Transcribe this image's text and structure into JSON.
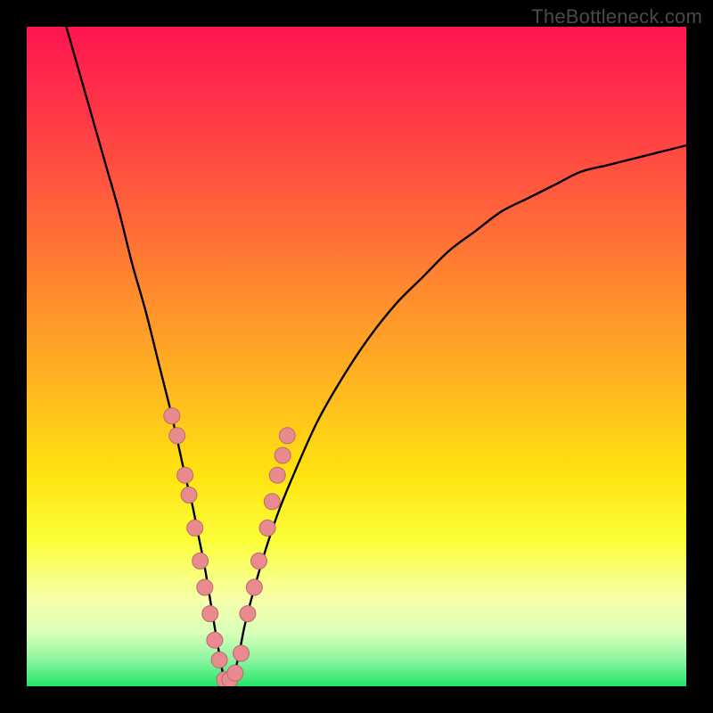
{
  "watermark": "TheBottleneck.com",
  "colors": {
    "frame": "#000000",
    "curve": "#000000",
    "marker_fill": "#e98a8f",
    "marker_stroke": "#b96a6f",
    "gradient_stops": [
      "#ff1450",
      "#ff2f49",
      "#ff5a3d",
      "#ff8a2e",
      "#ffb81f",
      "#ffe310",
      "#fbff3a",
      "#f6ffac",
      "#d8ffb8",
      "#8cf5a0",
      "#22e56a"
    ]
  },
  "chart_data": {
    "type": "line",
    "title": "",
    "xlabel": "",
    "ylabel": "",
    "xlim": [
      0,
      100
    ],
    "ylim": [
      0,
      100
    ],
    "grid": false,
    "legend": false,
    "curve": {
      "name": "bottleneck-curve",
      "comment": "V-shaped curve. y is bottleneck %, x is relative component balance. Values estimated from pixel positions; minimum ≈ 0 at x ≈ 30.",
      "x": [
        6,
        8,
        10,
        12,
        14,
        16,
        18,
        20,
        22,
        24,
        25,
        26,
        27,
        28,
        29,
        30,
        31,
        32,
        33,
        34,
        36,
        38,
        40,
        44,
        48,
        52,
        56,
        60,
        64,
        68,
        72,
        76,
        80,
        84,
        88,
        92,
        96,
        100
      ],
      "y": [
        100,
        93,
        86,
        79,
        72,
        64,
        57,
        49,
        41,
        32,
        28,
        23,
        18,
        12,
        6,
        1,
        1,
        4,
        9,
        13,
        20,
        26,
        31,
        40,
        47,
        53,
        58,
        62,
        66,
        69,
        72,
        74,
        76,
        78,
        79,
        80,
        81,
        82
      ]
    },
    "markers": {
      "name": "sample-points",
      "comment": "Salmon dots clustered near the valley on both arms.",
      "points": [
        {
          "x": 22.0,
          "y": 41
        },
        {
          "x": 22.8,
          "y": 38
        },
        {
          "x": 24.0,
          "y": 32
        },
        {
          "x": 24.6,
          "y": 29
        },
        {
          "x": 25.5,
          "y": 24
        },
        {
          "x": 26.3,
          "y": 19
        },
        {
          "x": 27.0,
          "y": 15
        },
        {
          "x": 27.8,
          "y": 11
        },
        {
          "x": 28.5,
          "y": 7
        },
        {
          "x": 29.2,
          "y": 4
        },
        {
          "x": 30.0,
          "y": 1
        },
        {
          "x": 30.8,
          "y": 1
        },
        {
          "x": 31.6,
          "y": 2
        },
        {
          "x": 32.5,
          "y": 5
        },
        {
          "x": 33.5,
          "y": 11
        },
        {
          "x": 34.5,
          "y": 15
        },
        {
          "x": 35.2,
          "y": 19
        },
        {
          "x": 36.5,
          "y": 24
        },
        {
          "x": 37.2,
          "y": 28
        },
        {
          "x": 38.0,
          "y": 32
        },
        {
          "x": 38.8,
          "y": 35
        },
        {
          "x": 39.5,
          "y": 38
        }
      ]
    }
  }
}
